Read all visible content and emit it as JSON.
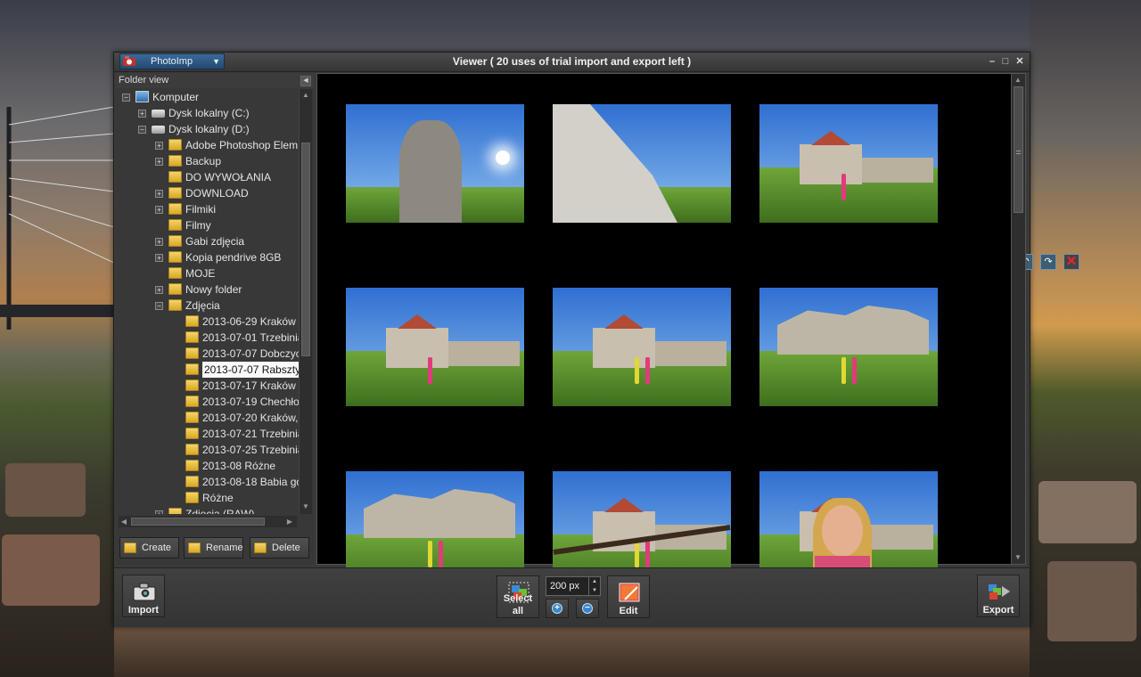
{
  "window": {
    "app_name": "PhotoImp",
    "title": "Viewer ( 20 uses of trial import and export left )",
    "controls": {
      "minimize": "–",
      "maximize": "□",
      "close": "✕"
    }
  },
  "folder_view": {
    "header": "Folder view",
    "tree": [
      {
        "label": "Komputer",
        "icon": "computer-icon",
        "level": 0,
        "expander": "−"
      },
      {
        "label": "Dysk lokalny (C:)",
        "icon": "drive-icon",
        "level": 1,
        "expander": "+"
      },
      {
        "label": "Dysk lokalny (D:)",
        "icon": "drive-icon",
        "level": 1,
        "expander": "−"
      },
      {
        "label": "Adobe Photoshop Elem",
        "icon": "folder-icon",
        "level": 2,
        "expander": "+"
      },
      {
        "label": "Backup",
        "icon": "folder-icon",
        "level": 2,
        "expander": "+"
      },
      {
        "label": "DO WYWOŁANIA",
        "icon": "folder-icon",
        "level": 2,
        "expander": ""
      },
      {
        "label": "DOWNLOAD",
        "icon": "folder-icon",
        "level": 2,
        "expander": "+"
      },
      {
        "label": "Filmiki",
        "icon": "folder-icon",
        "level": 2,
        "expander": "+"
      },
      {
        "label": "Filmy",
        "icon": "folder-icon",
        "level": 2,
        "expander": ""
      },
      {
        "label": "Gabi zdjęcia",
        "icon": "folder-icon",
        "level": 2,
        "expander": "+"
      },
      {
        "label": "Kopia pendrive 8GB",
        "icon": "folder-icon",
        "level": 2,
        "expander": "+"
      },
      {
        "label": "MOJE",
        "icon": "folder-icon",
        "level": 2,
        "expander": ""
      },
      {
        "label": "Nowy folder",
        "icon": "folder-icon",
        "level": 2,
        "expander": "+"
      },
      {
        "label": "Zdjęcia",
        "icon": "folder-icon",
        "level": 2,
        "expander": "−"
      },
      {
        "label": "2013-06-29 Kraków (",
        "icon": "folder-icon",
        "level": 3,
        "expander": ""
      },
      {
        "label": "2013-07-01 Trzebinia",
        "icon": "folder-icon",
        "level": 3,
        "expander": ""
      },
      {
        "label": "2013-07-07 Dobczyc",
        "icon": "folder-icon",
        "level": 3,
        "expander": ""
      },
      {
        "label": "2013-07-07 Rabsztyn",
        "icon": "folder-icon",
        "level": 3,
        "expander": "",
        "selected": true
      },
      {
        "label": "2013-07-17 Kraków",
        "icon": "folder-icon",
        "level": 3,
        "expander": ""
      },
      {
        "label": "2013-07-19 Chechło",
        "icon": "folder-icon",
        "level": 3,
        "expander": ""
      },
      {
        "label": "2013-07-20 Kraków,",
        "icon": "folder-icon",
        "level": 3,
        "expander": ""
      },
      {
        "label": "2013-07-21 Trzebinia",
        "icon": "folder-icon",
        "level": 3,
        "expander": ""
      },
      {
        "label": "2013-07-25 Trzebinia",
        "icon": "folder-icon",
        "level": 3,
        "expander": ""
      },
      {
        "label": "2013-08 Różne",
        "icon": "folder-icon",
        "level": 3,
        "expander": ""
      },
      {
        "label": "2013-08-18 Babia gó",
        "icon": "folder-icon",
        "level": 3,
        "expander": ""
      },
      {
        "label": "Różne",
        "icon": "folder-icon",
        "level": 3,
        "expander": ""
      },
      {
        "label": "Zdjęcia (RAW)",
        "icon": "folder-icon",
        "level": 2,
        "expander": "+"
      }
    ],
    "buttons": {
      "create": "Create",
      "rename": "Rename",
      "delete": "Delete"
    }
  },
  "viewer": {
    "thumbnails": [
      {
        "subject": "rock-spire-sun"
      },
      {
        "subject": "limestone-cliff"
      },
      {
        "subject": "castle-person"
      },
      {
        "subject": "castle-person"
      },
      {
        "subject": "castle-two-people"
      },
      {
        "subject": "ruin-two-people"
      },
      {
        "subject": "ruin-two-people-hill"
      },
      {
        "subject": "castle-fence-person"
      },
      {
        "subject": "castle-portrait"
      }
    ],
    "thumb_actions": [
      "rotate-left-icon",
      "rotate-right-icon",
      "delete-icon"
    ]
  },
  "toolbar": {
    "import": "Import",
    "select_all": "Select all",
    "size_value": "200 px",
    "zoom_in": "+",
    "zoom_out": "−",
    "edit": "Edit",
    "export": "Export"
  },
  "colors": {
    "accent": "#24496e",
    "panel": "#383838",
    "viewer_bg": "#000000",
    "folder": "#e6bb3a"
  }
}
